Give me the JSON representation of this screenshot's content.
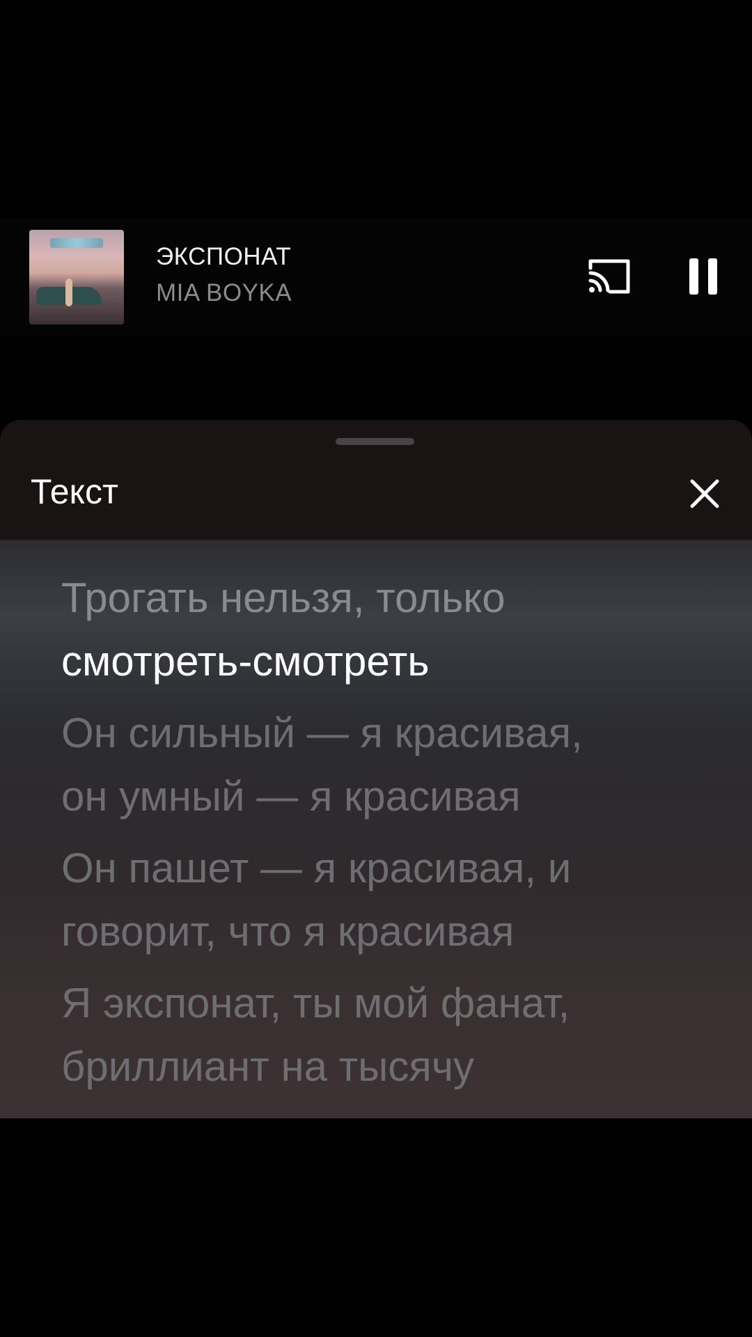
{
  "now_playing": {
    "title": "ЭКСПОНАТ",
    "artist": "MIA BOYKA",
    "album_art_icon": "album-cover",
    "cast_icon": "cast-icon",
    "pause_icon": "pause-icon"
  },
  "lyrics_sheet": {
    "title": "Текст",
    "close_icon": "close-icon",
    "lines": [
      {
        "state": "past",
        "parts": [
          "Трогать нельзя, только"
        ]
      },
      {
        "state": "active",
        "parts": [
          "смотреть-смотреть"
        ]
      },
      {
        "state": "upcoming",
        "parts": [
          "Он сильный — я красивая,",
          "он умный — я красивая"
        ]
      },
      {
        "state": "upcoming",
        "parts": [
          "Он пашет — я красивая, и",
          "говорит, что я красивая"
        ]
      },
      {
        "state": "upcoming",
        "parts": [
          "Я экспонат, ты мой фанат,",
          "бриллиант на тысячу"
        ]
      }
    ]
  },
  "colors": {
    "background": "#000000",
    "sheet": "#191314",
    "active_lyric": "#ffffff",
    "inactive_lyric": "#6e6e72",
    "artist_text": "#8d8a8d"
  }
}
